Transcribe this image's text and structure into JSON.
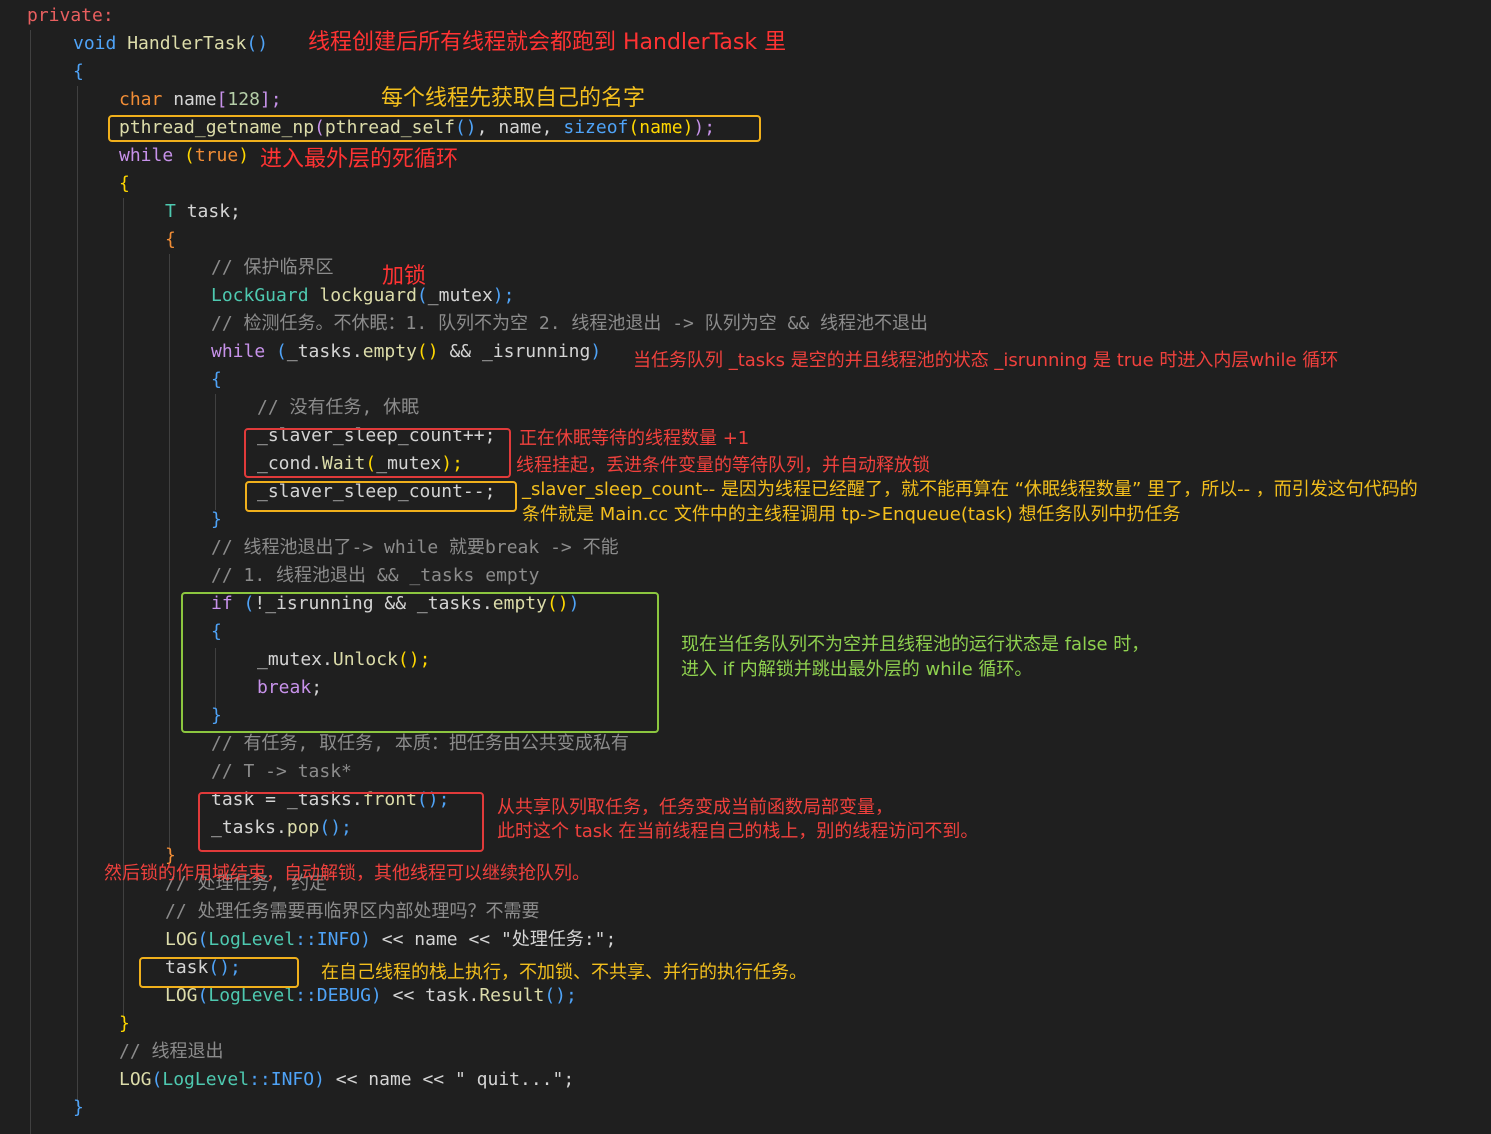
{
  "code": {
    "lines": [
      {
        "indent": 0,
        "tokens": [
          {
            "t": "private:",
            "c": "#e85f5f"
          }
        ]
      },
      {
        "indent": 1,
        "tokens": [
          {
            "t": "void ",
            "c": "#4fa3f7"
          },
          {
            "t": "HandlerTask",
            "c": "#dcdcaa"
          },
          {
            "t": "()",
            "c": "#4fa3f7"
          }
        ]
      },
      {
        "indent": 1,
        "tokens": [
          {
            "t": "{",
            "c": "#4fa3f7"
          }
        ]
      },
      {
        "indent": 2,
        "tokens": [
          {
            "t": "char ",
            "c": "#f18d36"
          },
          {
            "t": "name",
            "c": "#d4d4d4"
          },
          {
            "t": "[",
            "c": "#c792ea"
          },
          {
            "t": "128",
            "c": "#b5cea8"
          },
          {
            "t": "];",
            "c": "#c792ea"
          }
        ]
      },
      {
        "indent": 2,
        "tokens": [
          {
            "t": "pthread_getname_np",
            "c": "#dcdcaa"
          },
          {
            "t": "(",
            "c": "#c792ea"
          },
          {
            "t": "pthread_self",
            "c": "#dcdcaa"
          },
          {
            "t": "()",
            "c": "#4fa3f7"
          },
          {
            "t": ", name, ",
            "c": "#d4d4d4"
          },
          {
            "t": "sizeof",
            "c": "#4fa3f7"
          },
          {
            "t": "(name)",
            "c": "#ffd700"
          },
          {
            "t": ");",
            "c": "#c792ea"
          }
        ]
      },
      {
        "indent": 2,
        "tokens": [
          {
            "t": "while ",
            "c": "#c792ea"
          },
          {
            "t": "(",
            "c": "#ffd700"
          },
          {
            "t": "true",
            "c": "#f18d36"
          },
          {
            "t": ")",
            "c": "#ffd700"
          }
        ]
      },
      {
        "indent": 2,
        "tokens": [
          {
            "t": "{",
            "c": "#ffd700"
          }
        ]
      },
      {
        "indent": 3,
        "tokens": [
          {
            "t": "T ",
            "c": "#4ec9b0"
          },
          {
            "t": "task;",
            "c": "#d4d4d4"
          }
        ]
      },
      {
        "indent": 3,
        "tokens": [
          {
            "t": "{",
            "c": "#f18d36"
          }
        ]
      },
      {
        "indent": 4,
        "tokens": [
          {
            "t": "// 保护临界区",
            "c": "#8c8c8c"
          }
        ]
      },
      {
        "indent": 4,
        "tokens": [
          {
            "t": "LockGuard ",
            "c": "#4ec9b0"
          },
          {
            "t": "lockguard",
            "c": "#dcdcaa"
          },
          {
            "t": "(",
            "c": "#4fa3f7"
          },
          {
            "t": "_mutex",
            "c": "#d4d4d4"
          },
          {
            "t": ");",
            "c": "#4fa3f7"
          }
        ]
      },
      {
        "indent": 4,
        "tokens": [
          {
            "t": "// 检测任务。不休眠：1. 队列不为空 2. 线程池退出 -> 队列为空 && 线程池不退出",
            "c": "#8c8c8c"
          }
        ]
      },
      {
        "indent": 4,
        "tokens": [
          {
            "t": "while ",
            "c": "#c792ea"
          },
          {
            "t": "(",
            "c": "#4fa3f7"
          },
          {
            "t": "_tasks.",
            "c": "#d4d4d4"
          },
          {
            "t": "empty",
            "c": "#dcdcaa"
          },
          {
            "t": "()",
            "c": "#ffd700"
          },
          {
            "t": " && _isrunning",
            "c": "#d4d4d4"
          },
          {
            "t": ")",
            "c": "#4fa3f7"
          }
        ]
      },
      {
        "indent": 4,
        "tokens": [
          {
            "t": "{",
            "c": "#4fa3f7"
          }
        ]
      },
      {
        "indent": 5,
        "tokens": [
          {
            "t": "// 没有任务, 休眠",
            "c": "#8c8c8c"
          }
        ]
      },
      {
        "indent": 5,
        "tokens": [
          {
            "t": "_slaver_sleep_count++;",
            "c": "#d4d4d4"
          }
        ]
      },
      {
        "indent": 5,
        "tokens": [
          {
            "t": "_cond.",
            "c": "#d4d4d4"
          },
          {
            "t": "Wait",
            "c": "#dcdcaa"
          },
          {
            "t": "(",
            "c": "#ffd700"
          },
          {
            "t": "_mutex",
            "c": "#d4d4d4"
          },
          {
            "t": ");",
            "c": "#ffd700"
          }
        ]
      },
      {
        "indent": 5,
        "tokens": [
          {
            "t": "_slaver_sleep_count--;",
            "c": "#d4d4d4"
          }
        ]
      },
      {
        "indent": 4,
        "tokens": [
          {
            "t": "}",
            "c": "#4fa3f7"
          }
        ]
      },
      {
        "indent": 4,
        "tokens": [
          {
            "t": "// 线程池退出了-> while 就要break -> 不能",
            "c": "#8c8c8c"
          }
        ]
      },
      {
        "indent": 4,
        "tokens": [
          {
            "t": "// 1. 线程池退出 && _tasks empty",
            "c": "#8c8c8c"
          }
        ]
      },
      {
        "indent": 4,
        "tokens": [
          {
            "t": "if ",
            "c": "#c792ea"
          },
          {
            "t": "(",
            "c": "#4fa3f7"
          },
          {
            "t": "!_isrunning && _tasks.",
            "c": "#d4d4d4"
          },
          {
            "t": "empty",
            "c": "#dcdcaa"
          },
          {
            "t": "()",
            "c": "#ffd700"
          },
          {
            "t": ")",
            "c": "#4fa3f7"
          }
        ]
      },
      {
        "indent": 4,
        "tokens": [
          {
            "t": "{",
            "c": "#4fa3f7"
          }
        ]
      },
      {
        "indent": 5,
        "tokens": [
          {
            "t": "_mutex.",
            "c": "#d4d4d4"
          },
          {
            "t": "Unlock",
            "c": "#dcdcaa"
          },
          {
            "t": "();",
            "c": "#ffd700"
          }
        ]
      },
      {
        "indent": 5,
        "tokens": [
          {
            "t": "break",
            "c": "#c792ea"
          },
          {
            "t": ";",
            "c": "#d4d4d4"
          }
        ]
      },
      {
        "indent": 4,
        "tokens": [
          {
            "t": "}",
            "c": "#4fa3f7"
          }
        ]
      },
      {
        "indent": 4,
        "tokens": [
          {
            "t": "// 有任务, 取任务, 本质：把任务由公共变成私有",
            "c": "#8c8c8c"
          }
        ]
      },
      {
        "indent": 4,
        "tokens": [
          {
            "t": "// T -> task*",
            "c": "#8c8c8c"
          }
        ]
      },
      {
        "indent": 4,
        "tokens": [
          {
            "t": "task = _tasks.",
            "c": "#d4d4d4"
          },
          {
            "t": "front",
            "c": "#dcdcaa"
          },
          {
            "t": "();",
            "c": "#4fa3f7"
          }
        ]
      },
      {
        "indent": 4,
        "tokens": [
          {
            "t": "_tasks.",
            "c": "#d4d4d4"
          },
          {
            "t": "pop",
            "c": "#dcdcaa"
          },
          {
            "t": "();",
            "c": "#4fa3f7"
          }
        ]
      },
      {
        "indent": 3,
        "tokens": [
          {
            "t": "}",
            "c": "#f18d36"
          }
        ]
      },
      {
        "indent": 3,
        "tokens": [
          {
            "t": "// 处理任务, 约定",
            "c": "#8c8c8c"
          }
        ]
      },
      {
        "indent": 3,
        "tokens": [
          {
            "t": "// 处理任务需要再临界区内部处理吗？不需要",
            "c": "#8c8c8c"
          }
        ]
      },
      {
        "indent": 3,
        "tokens": [
          {
            "t": "LOG",
            "c": "#dcdcaa"
          },
          {
            "t": "(",
            "c": "#4fa3f7"
          },
          {
            "t": "LogLevel",
            "c": "#4ec9b0"
          },
          {
            "t": "::INFO",
            "c": "#4fa3f7"
          },
          {
            "t": ")",
            "c": "#4fa3f7"
          },
          {
            "t": " << name << ",
            "c": "#d4d4d4"
          },
          {
            "t": "\"处理任务:\";",
            "c": "#d4d4d4"
          }
        ]
      },
      {
        "indent": 3,
        "tokens": [
          {
            "t": "task",
            "c": "#d4d4d4"
          },
          {
            "t": "();",
            "c": "#4fa3f7"
          }
        ]
      },
      {
        "indent": 3,
        "tokens": [
          {
            "t": "LOG",
            "c": "#dcdcaa"
          },
          {
            "t": "(",
            "c": "#4fa3f7"
          },
          {
            "t": "LogLevel",
            "c": "#4ec9b0"
          },
          {
            "t": "::DEBUG",
            "c": "#4fa3f7"
          },
          {
            "t": ")",
            "c": "#4fa3f7"
          },
          {
            "t": " << task.",
            "c": "#d4d4d4"
          },
          {
            "t": "Result",
            "c": "#dcdcaa"
          },
          {
            "t": "();",
            "c": "#4fa3f7"
          }
        ]
      },
      {
        "indent": 2,
        "tokens": [
          {
            "t": "}",
            "c": "#ffd700"
          }
        ]
      },
      {
        "indent": 2,
        "tokens": [
          {
            "t": "// 线程退出",
            "c": "#8c8c8c"
          }
        ]
      },
      {
        "indent": 2,
        "tokens": [
          {
            "t": "LOG",
            "c": "#dcdcaa"
          },
          {
            "t": "(",
            "c": "#4fa3f7"
          },
          {
            "t": "LogLevel",
            "c": "#4ec9b0"
          },
          {
            "t": "::INFO",
            "c": "#4fa3f7"
          },
          {
            "t": ")",
            "c": "#4fa3f7"
          },
          {
            "t": " << name << ",
            "c": "#d4d4d4"
          },
          {
            "t": "\" quit...\";",
            "c": "#d4d4d4"
          }
        ]
      },
      {
        "indent": 1,
        "tokens": [
          {
            "t": "}",
            "c": "#4fa3f7"
          }
        ]
      }
    ]
  },
  "notes": {
    "handler_task": "线程创建后所有线程就会都跑到 HandlerTask 里",
    "get_name": "每个线程先获取自己的名字",
    "outer_loop": "进入最外层的死循环",
    "lock": "加锁",
    "inner_loop": "当任务队列 _tasks 是空的并且线程池的状态 _isrunning 是 true 时进入内层while 循环",
    "sleep_count_inc": "正在休眠等待的线程数量 +1",
    "cond_wait": "线程挂起，丢进条件变量的等待队列，并自动释放锁",
    "sleep_count_dec_1": "_slaver_sleep_count-- 是因为线程已经醒了，就不能再算在 “休眠线程数量” 里了，所以-- ，而引发这句代码的",
    "sleep_count_dec_2": "条件就是 Main.cc 文件中的主线程调用 tp->Enqueue(task) 想任务队列中扔任务",
    "exit_check_1": "现在当任务队列不为空并且线程池的运行状态是 false 时，",
    "exit_check_2": "进入 if 内解锁并跳出最外层的 while 循环。",
    "take_task_1": "从共享队列取任务，任务变成当前函数局部变量，",
    "take_task_2": "此时这个 task 在当前线程自己的栈上，别的线程访问不到。",
    "unlock_scope": "然后锁的作用域结束，自动解锁，其他线程可以继续抢队列。",
    "exec_task": "在自己线程的栈上执行，不加锁、不共享、并行的执行任务。"
  }
}
